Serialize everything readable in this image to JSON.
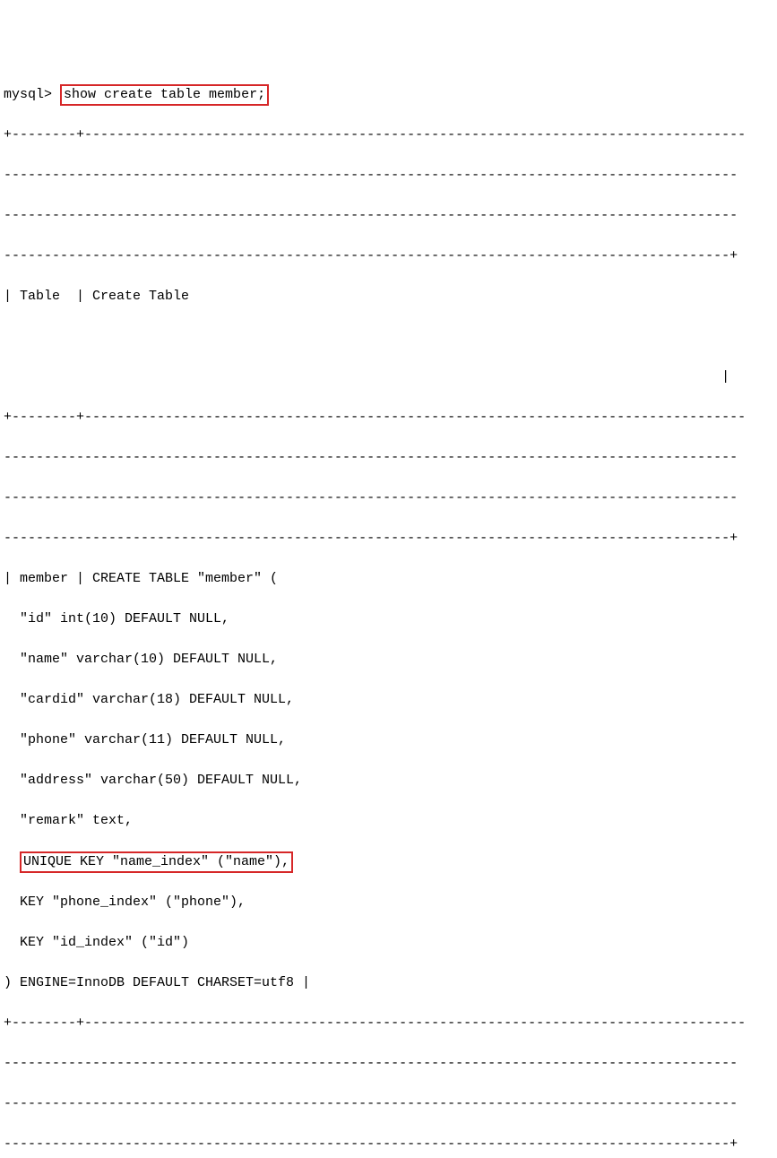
{
  "prompt": "mysql>",
  "command": "show create table member;",
  "sep_short": "+--------+----------------------------------------------------------------------------------",
  "sep_dashes": "-------------------------------------------------------------------------------------------",
  "sep_dashes_end": "------------------------------------------------------------------------------------------+",
  "header_row": "| Table  | Create Table",
  "header_blank1": "",
  "header_blank2": "",
  "header_blank3": "                                                                                         |",
  "body_line1": "| member | CREATE TABLE \"member\" (",
  "body_line2": "  \"id\" int(10) DEFAULT NULL,",
  "body_line3": "  \"name\" varchar(10) DEFAULT NULL,",
  "body_line4": "  \"cardid\" varchar(18) DEFAULT NULL,",
  "body_line5": "  \"phone\" varchar(11) DEFAULT NULL,",
  "body_line6": "  \"address\" varchar(50) DEFAULT NULL,",
  "body_line7": "  \"remark\" text,",
  "body_line8_pre": "  ",
  "body_line8_hl": "UNIQUE KEY \"name_index\" (\"name\"),",
  "body_line9": "  KEY \"phone_index\" (\"phone\"),",
  "body_line10": "  KEY \"id_index\" (\"id\")",
  "body_line11": ") ENGINE=InnoDB DEFAULT CHARSET=utf8 |"
}
